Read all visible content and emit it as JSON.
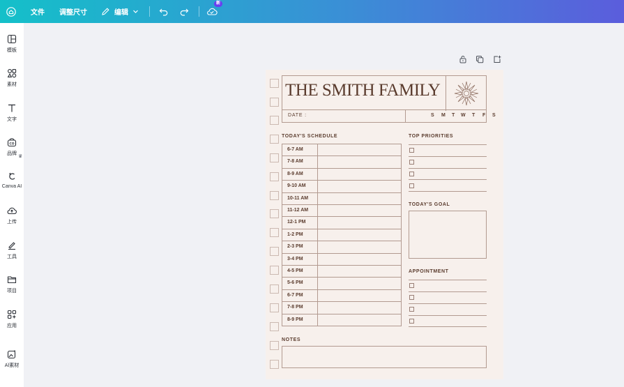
{
  "topbar": {
    "file": "文件",
    "resize": "调整尺寸",
    "edit": "编辑",
    "new_badge": "新"
  },
  "sidebar": {
    "items": [
      {
        "label": "模板",
        "icon": "template-icon"
      },
      {
        "label": "素材",
        "icon": "elements-icon"
      },
      {
        "label": "文字",
        "icon": "text-icon"
      },
      {
        "label": "品牌",
        "icon": "brand-icon"
      },
      {
        "label": "Canva AI",
        "icon": "canva-ai-icon"
      },
      {
        "label": "上传",
        "icon": "upload-icon"
      },
      {
        "label": "工具",
        "icon": "tools-icon"
      },
      {
        "label": "项目",
        "icon": "projects-icon"
      },
      {
        "label": "应用",
        "icon": "apps-icon"
      },
      {
        "label": "AI素材",
        "icon": "ai-elements-icon"
      }
    ]
  },
  "planner": {
    "title": "THE SMITH FAMILY",
    "date_label": "DATE :",
    "days": [
      "S",
      "M",
      "T",
      "W",
      "T",
      "F",
      "S"
    ],
    "schedule_heading": "TODAY'S SCHEDULE",
    "schedule": [
      "6-7 AM",
      "7-8 AM",
      "8-9 AM",
      "9-10 AM",
      "10-11 AM",
      "11-12 AM",
      "12-1 PM",
      "1-2 PM",
      "2-3 PM",
      "3-4 PM",
      "4-5 PM",
      "5-6 PM",
      "6-7 PM",
      "7-8 PM",
      "8-9 PM"
    ],
    "priorities_heading": "TOP PRIORITIES",
    "goal_heading": "TODAY'S GOAL",
    "appointment_heading": "APPOINTMENT",
    "notes_heading": "NOTES"
  },
  "colors": {
    "accent_brown": "#5a3b2d",
    "page_bg": "#f7f0ec",
    "topbar_start": "#14c0c9",
    "topbar_end": "#5b5ddc"
  }
}
